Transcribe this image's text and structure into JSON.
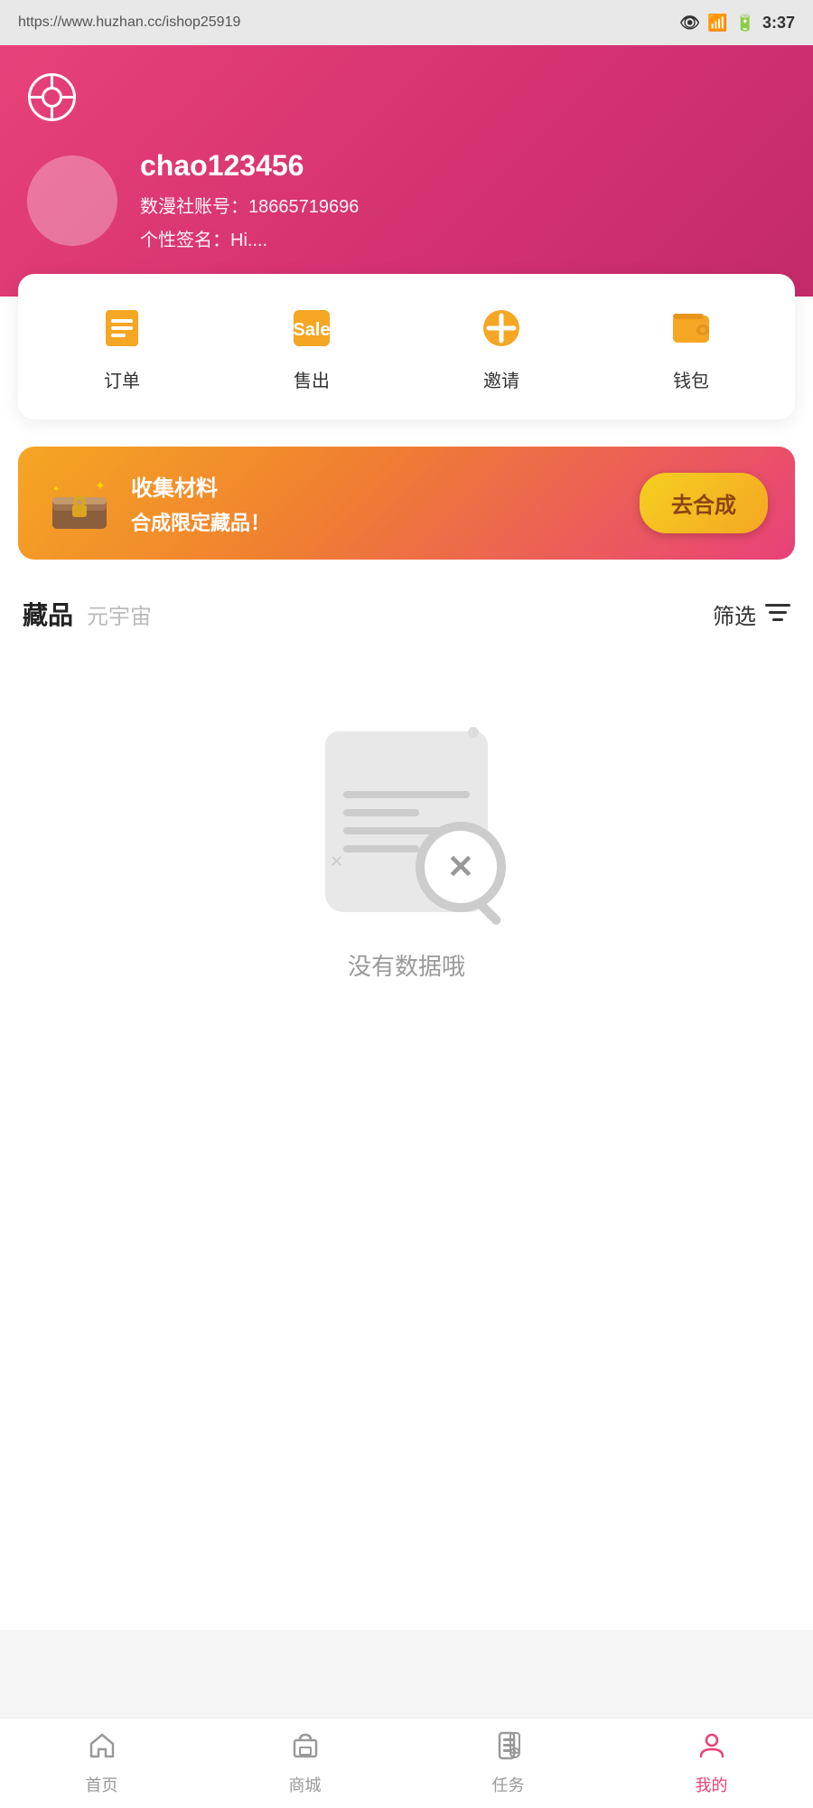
{
  "statusBar": {
    "url": "https://www.huzhan.cc/ishop25919",
    "time": "3:37"
  },
  "profile": {
    "username": "chao123456",
    "accountLabel": "数漫社账号：",
    "accountNumber": "18665719696",
    "signatureLabel": "个性签名：",
    "signature": "Hi...."
  },
  "actions": [
    {
      "id": "order",
      "label": "订单",
      "icon": "📋"
    },
    {
      "id": "sale",
      "label": "售出",
      "icon": "🏷️"
    },
    {
      "id": "invite",
      "label": "邀请",
      "icon": "➕"
    },
    {
      "id": "wallet",
      "label": "钱包",
      "icon": "👛"
    }
  ],
  "banner": {
    "title": "收集材料",
    "subtitle": "合成限定藏品！",
    "buttonText": "去合成"
  },
  "collections": {
    "title": "藏品",
    "subtitle": "元宇宙",
    "filterLabel": "筛选"
  },
  "emptyState": {
    "message": "没有数据哦"
  },
  "bottomNav": [
    {
      "id": "home",
      "label": "首页",
      "active": false
    },
    {
      "id": "shop",
      "label": "商城",
      "active": false
    },
    {
      "id": "task",
      "label": "任务",
      "active": false
    },
    {
      "id": "mine",
      "label": "我的",
      "active": true
    }
  ]
}
